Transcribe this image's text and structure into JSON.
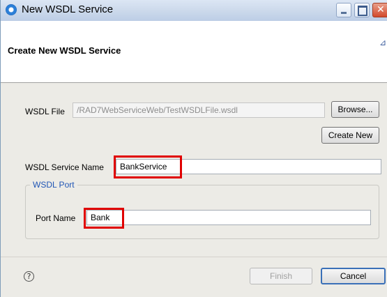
{
  "window": {
    "title": "New WSDL Service",
    "header_title": "Create New WSDL Service"
  },
  "form": {
    "wsdl_file_label": "WSDL File",
    "wsdl_file_value": "/RAD7WebServiceWeb/TestWSDLFile.wsdl",
    "browse_label": "Browse...",
    "create_new_label": "Create New",
    "service_name_label": "WSDL Service Name",
    "service_name_value": "BankService",
    "port_group_title": "WSDL Port",
    "port_name_label": "Port Name",
    "port_name_value": "Bank"
  },
  "footer": {
    "help_icon": "?",
    "finish_label": "Finish",
    "cancel_label": "Cancel"
  },
  "icons": {
    "title": "wsdl-service-icon",
    "help": "help-icon"
  },
  "colors": {
    "highlight": "#e00000",
    "group_title": "#1f55b5"
  }
}
